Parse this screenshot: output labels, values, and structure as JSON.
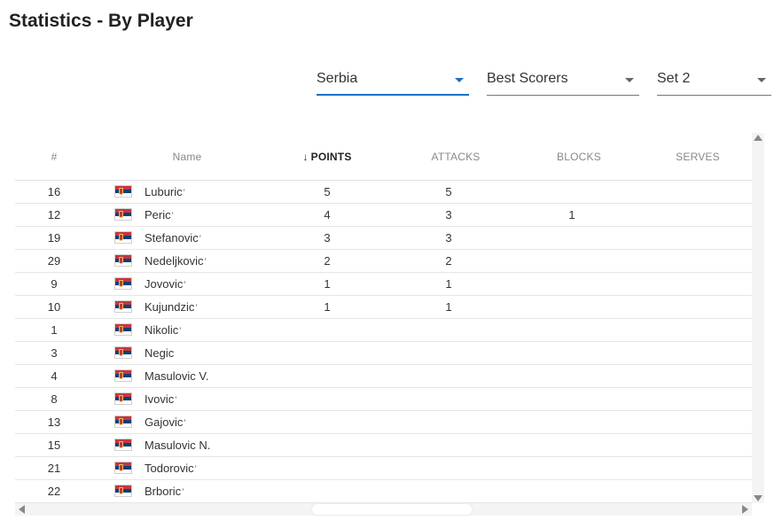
{
  "page": {
    "title": "Statistics - By Player"
  },
  "filters": {
    "team": "Serbia",
    "category": "Best Scorers",
    "set": "Set 2"
  },
  "table": {
    "headers": {
      "num": "#",
      "name": "Name",
      "points": "POINTS",
      "attacks": "ATTACKS",
      "blocks": "BLOCKS",
      "serves": "SERVES"
    },
    "sort_arrow": "↓",
    "tick": "ʼ",
    "rows": [
      {
        "num": "16",
        "name": "Luburic",
        "tick": "ʼ",
        "points": "5",
        "attacks": "5",
        "blocks": "",
        "serves": ""
      },
      {
        "num": "12",
        "name": "Peric",
        "tick": "ʼ",
        "points": "4",
        "attacks": "3",
        "blocks": "1",
        "serves": ""
      },
      {
        "num": "19",
        "name": "Stefanovic",
        "tick": "ʼ",
        "points": "3",
        "attacks": "3",
        "blocks": "",
        "serves": ""
      },
      {
        "num": "29",
        "name": "Nedeljkovic",
        "tick": "ʼ",
        "points": "2",
        "attacks": "2",
        "blocks": "",
        "serves": ""
      },
      {
        "num": "9",
        "name": "Jovovic",
        "tick": "ʼ",
        "points": "1",
        "attacks": "1",
        "blocks": "",
        "serves": ""
      },
      {
        "num": "10",
        "name": "Kujundzic",
        "tick": "ʼ",
        "points": "1",
        "attacks": "1",
        "blocks": "",
        "serves": ""
      },
      {
        "num": "1",
        "name": "Nikolic",
        "tick": "ʼ",
        "points": "",
        "attacks": "",
        "blocks": "",
        "serves": ""
      },
      {
        "num": "3",
        "name": "Negic",
        "tick": "",
        "points": "",
        "attacks": "",
        "blocks": "",
        "serves": ""
      },
      {
        "num": "4",
        "name": "Masulovic V.",
        "tick": "",
        "points": "",
        "attacks": "",
        "blocks": "",
        "serves": ""
      },
      {
        "num": "8",
        "name": "Ivovic",
        "tick": "ʼ",
        "points": "",
        "attacks": "",
        "blocks": "",
        "serves": ""
      },
      {
        "num": "13",
        "name": "Gajovic",
        "tick": "ʼ",
        "points": "",
        "attacks": "",
        "blocks": "",
        "serves": ""
      },
      {
        "num": "15",
        "name": "Masulovic N.",
        "tick": "",
        "points": "",
        "attacks": "",
        "blocks": "",
        "serves": ""
      },
      {
        "num": "21",
        "name": "Todorovic",
        "tick": "ʼ",
        "points": "",
        "attacks": "",
        "blocks": "",
        "serves": ""
      },
      {
        "num": "22",
        "name": "Brboric",
        "tick": "ʼ",
        "points": "",
        "attacks": "",
        "blocks": "",
        "serves": ""
      }
    ]
  },
  "colors": {
    "accent": "#1a6fc4",
    "flag_red": "#c6363c",
    "flag_blue": "#0c4076",
    "flag_white": "#ffffff"
  },
  "icons": {
    "dropdown": "chevron-down-icon",
    "sort": "sort-down-icon",
    "flag": "serbia-flag-icon"
  }
}
